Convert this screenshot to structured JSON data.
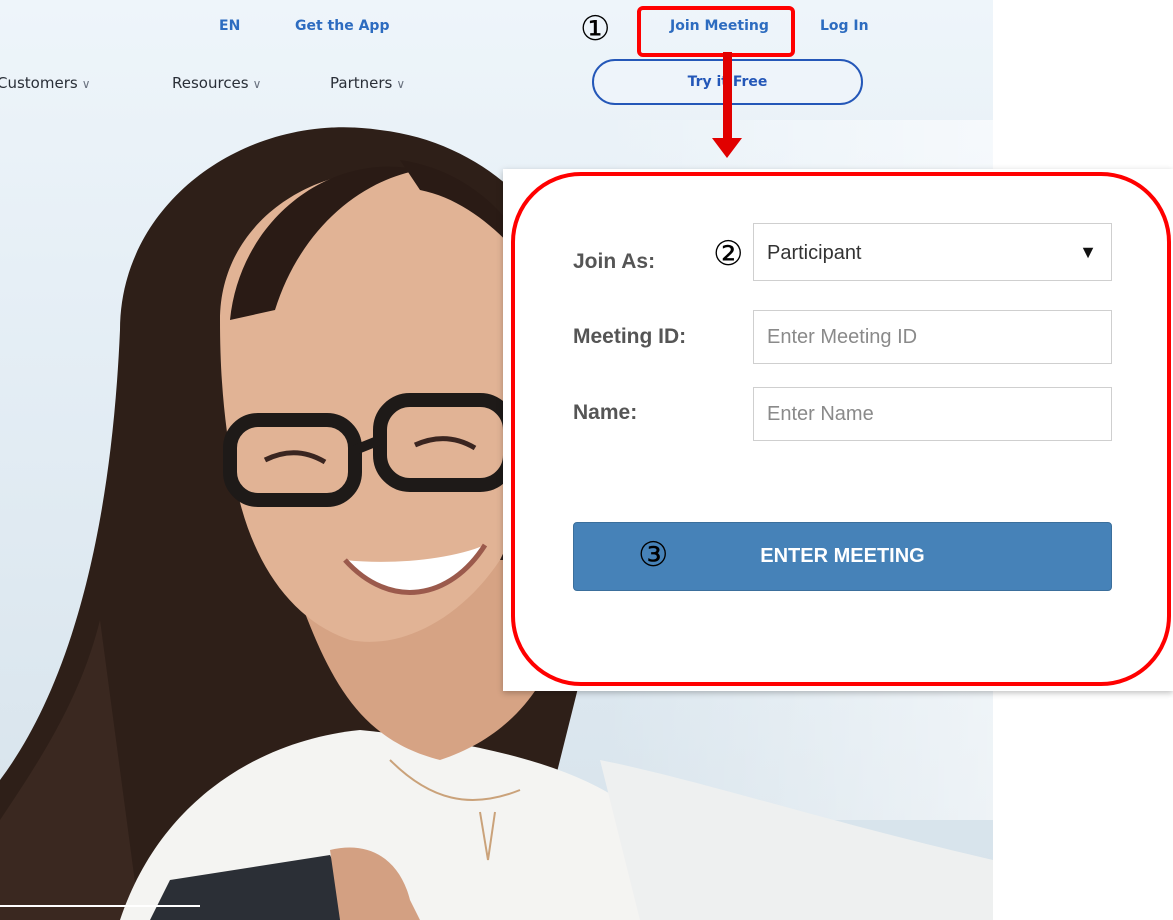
{
  "header": {
    "lang": "EN",
    "get_app": "Get the App",
    "join_meeting": "Join Meeting",
    "log_in": "Log In",
    "try_free": "Try it Free"
  },
  "nav": {
    "items": [
      {
        "label": "Customers",
        "chevron": "∨"
      },
      {
        "label": "Resources",
        "chevron": "∨"
      },
      {
        "label": "Partners",
        "chevron": "∨"
      }
    ]
  },
  "annotations": {
    "step1": "①",
    "step2": "②",
    "step3": "③"
  },
  "join_form": {
    "join_as_label": "Join As:",
    "join_as_value": "Participant",
    "caret": "▼",
    "meeting_id_label": "Meeting ID:",
    "meeting_id_placeholder": "Enter Meeting ID",
    "name_label": "Name:",
    "name_placeholder": "Enter Name",
    "enter_button": "ENTER MEETING"
  },
  "colors": {
    "link": "#2d6cc0",
    "annotation_red": "#ff0000",
    "button_blue": "#4682b8"
  }
}
